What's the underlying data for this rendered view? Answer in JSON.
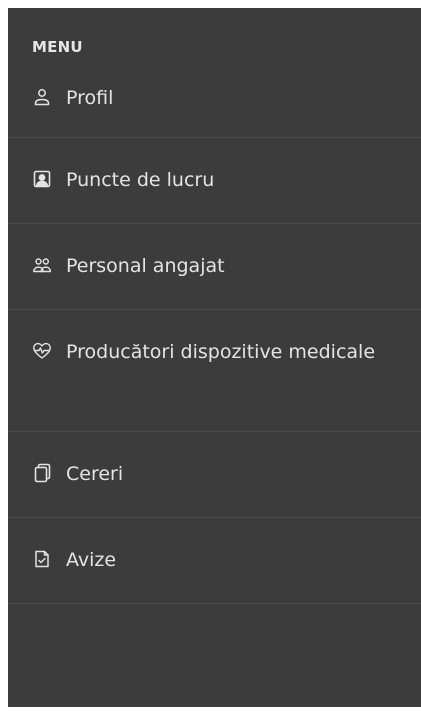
{
  "menu": {
    "header": "MENU",
    "items": [
      {
        "label": "Profil",
        "icon": "user-icon"
      },
      {
        "label": "Puncte de lucru",
        "icon": "workplace-icon"
      },
      {
        "label": "Personal angajat",
        "icon": "users-icon"
      },
      {
        "label": "Producători dispozitive medicale",
        "icon": "heart-pulse-icon"
      },
      {
        "label": "Cereri",
        "icon": "documents-icon"
      },
      {
        "label": "Avize",
        "icon": "file-check-icon"
      }
    ]
  },
  "colors": {
    "background": "#3c3c3c",
    "text": "#e4e4e4",
    "divider": "#4a4a4a"
  }
}
